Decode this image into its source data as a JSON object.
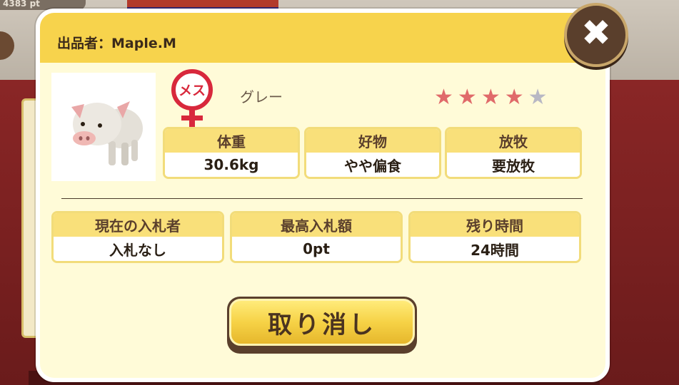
{
  "background": {
    "points_text": "4383 pt"
  },
  "dialog": {
    "seller": "出品者：Maple.M",
    "close_label": "✖",
    "gender_label": "メス",
    "color_name": "グレー",
    "rating": {
      "value": 4,
      "max": 5
    },
    "stats_top": [
      {
        "label": "体重",
        "value": "30.6kg"
      },
      {
        "label": "好物",
        "value": "やや偏食"
      },
      {
        "label": "放牧",
        "value": "要放牧"
      }
    ],
    "stats_bottom": [
      {
        "label": "現在の入札者",
        "value": "入札なし"
      },
      {
        "label": "最高入札額",
        "value": "0pt"
      },
      {
        "label": "残り時間",
        "value": "24時間"
      }
    ],
    "cancel_label": "取り消し"
  },
  "colors": {
    "header_yellow": "#f7d34c",
    "panel_cream": "#fffbd8",
    "star_filled": "#e06a6a",
    "star_empty": "#b8b8c4",
    "gender_red": "#d8283c"
  }
}
